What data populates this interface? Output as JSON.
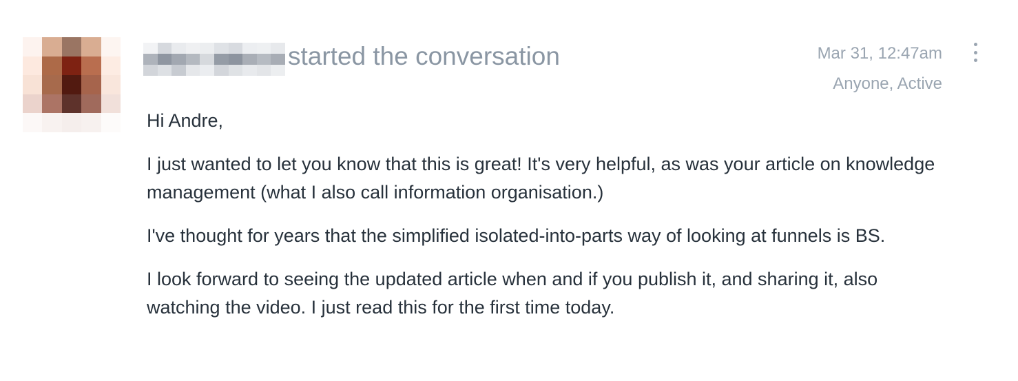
{
  "post": {
    "action_text": "started the conversation",
    "timestamp": "Mar 31, 12:47am",
    "visibility_status": "Anyone, Active",
    "more_icon": "vertical-ellipsis-icon",
    "avatar_icon": "pixelated-avatar",
    "body": {
      "greeting": "Hi Andre,",
      "paragraph_1": "I just wanted to let you know that this is great! It's very helpful, as was your article on knowledge management (what I also call information organisation.)",
      "paragraph_2": "I've thought for years that the simplified isolated-into-parts way of looking at funnels is BS.",
      "paragraph_3": "I look forward to seeing the updated article when and if you publish it, and sharing it, also watching the video. I just read this for the first time today."
    }
  },
  "colors": {
    "action_text": "#8a96a3",
    "meta_text": "#9aa5b1",
    "body_text": "#27313b",
    "background": "#ffffff"
  }
}
